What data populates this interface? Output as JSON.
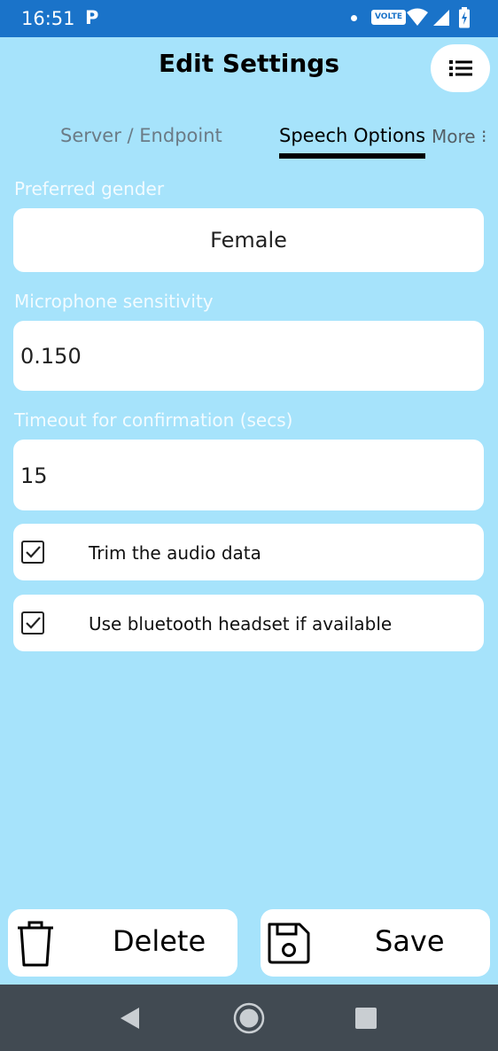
{
  "status_bar": {
    "time": "16:51",
    "app_badge": "P",
    "volte": "VOLTE",
    "wifi_icon": "wifi-icon",
    "signal_icon": "cell-signal-icon",
    "battery_icon": "battery-charging-icon"
  },
  "header": {
    "title": "Edit Settings",
    "menu_icon": "list-menu-icon"
  },
  "tabs": [
    {
      "label": "Server / Endpoint",
      "selected": false
    },
    {
      "label": "Speech Options",
      "selected": true
    },
    {
      "label": "More ⁝",
      "selected": false
    }
  ],
  "form": {
    "preferred_gender": {
      "label": "Preferred gender",
      "value": "Female"
    },
    "mic_sensitivity": {
      "label": "Microphone sensitivity",
      "value": "0.150"
    },
    "timeout": {
      "label": "Timeout for confirmation (secs)",
      "value": "15"
    },
    "checkboxes": [
      {
        "label": "Trim the audio data",
        "checked": true
      },
      {
        "label": "Use bluetooth headset if available",
        "checked": true
      }
    ]
  },
  "actions": {
    "delete": {
      "label": "Delete",
      "icon": "trash-icon"
    },
    "save": {
      "label": "Save",
      "icon": "floppy-disk-icon"
    }
  },
  "nav_bar": {
    "back_icon": "back-triangle-icon",
    "home_icon": "home-circle-icon",
    "recents_icon": "recents-square-icon"
  },
  "colors": {
    "background": "#a6e3fb",
    "status_bar": "#1a73c9",
    "nav_bar": "#414a52",
    "card": "#ffffff",
    "label_text": "#f2fbff"
  }
}
